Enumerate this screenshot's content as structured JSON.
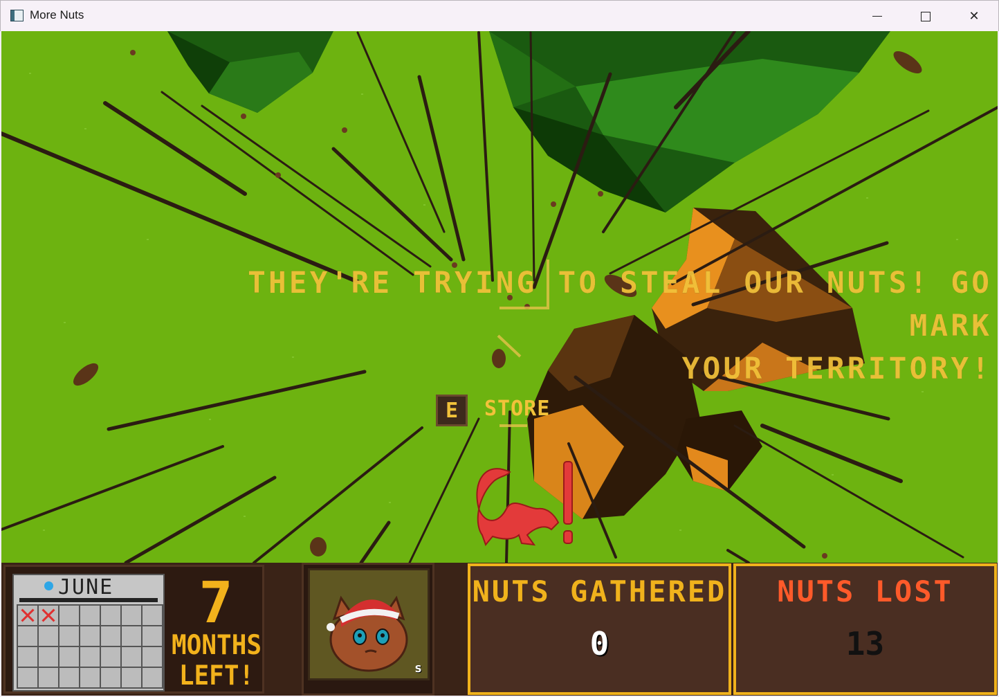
{
  "window": {
    "title": "More Nuts",
    "controls": {
      "minimize": "minimize",
      "maximize": "maximize",
      "close": "✕"
    }
  },
  "game": {
    "banner_lines": [
      "THEY'RE TRYING TO STEAL OUR NUTS! GO MARK",
      "YOUR TERRITORY!"
    ],
    "interaction_prompt": {
      "key": "E",
      "label": "STORE"
    },
    "alert_symbol": "!"
  },
  "hud": {
    "calendar": {
      "month": "JUNE",
      "days_crossed": 2,
      "rows": 4,
      "cols": 7
    },
    "months_left": {
      "number": "7",
      "label_line1": "MONTHS",
      "label_line2": "LEFT!"
    },
    "portrait": {
      "badge": "s"
    },
    "nuts_gathered": {
      "label": "NUTS GATHERED",
      "value": "0"
    },
    "nuts_lost": {
      "label": "NUTS LOST",
      "value": "13"
    }
  },
  "colors": {
    "grass": "#6db310",
    "tree": "#1f6b12",
    "hud_accent": "#f0b21c",
    "lost_red": "#ff5a2a",
    "banner_yellow": "#f2c23a"
  }
}
